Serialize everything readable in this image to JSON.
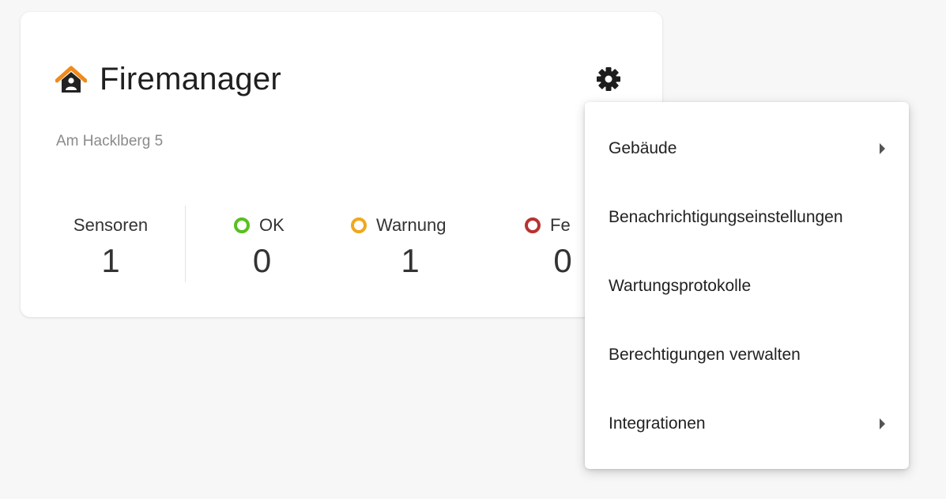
{
  "card": {
    "title": "Firemanager",
    "address": "Am Hacklberg 5",
    "stats": {
      "sensors": {
        "label": "Sensoren",
        "value": "1"
      },
      "ok": {
        "label": "OK",
        "value": "0",
        "color": "#57c01e"
      },
      "warning": {
        "label": "Warnung",
        "value": "1",
        "color": "#f0a81c"
      },
      "error": {
        "label": "Fe",
        "value": "0",
        "color": "#b83232"
      }
    },
    "icons": {
      "home": "home-icon",
      "settings": "gear-icon"
    }
  },
  "menu": {
    "items": [
      {
        "label": "Gebäude",
        "submenu": true
      },
      {
        "label": "Benachrichtigungseinstellungen",
        "submenu": false
      },
      {
        "label": "Wartungsprotokolle",
        "submenu": false
      },
      {
        "label": "Berechtigungen verwalten",
        "submenu": false
      },
      {
        "label": "Integrationen",
        "submenu": true
      }
    ]
  }
}
